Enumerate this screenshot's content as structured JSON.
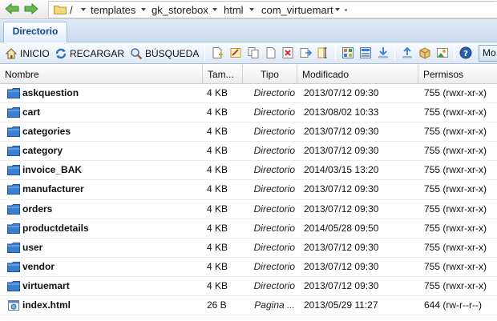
{
  "breadcrumb": {
    "items": [
      "/",
      "templates",
      "gk_storebox",
      "html",
      "com_virtuemart"
    ]
  },
  "tabs": [
    {
      "label": "Directorio"
    }
  ],
  "toolbar": {
    "home_label": "INICIO",
    "reload_label": "RECARGAR",
    "search_label": "BÚSQUEDA",
    "mode_label": "Mo"
  },
  "columns": {
    "name": "Nombre",
    "size": "Tam...",
    "type": "Tipo",
    "modified": "Modificado",
    "permissions": "Permisos"
  },
  "files": [
    {
      "name": "askquestion",
      "size": "4 KB",
      "type": "Directorio",
      "modified": "2013/07/12 09:30",
      "permissions": "755 (rwxr-xr-x)",
      "icon": "folder-icon"
    },
    {
      "name": "cart",
      "size": "4 KB",
      "type": "Directorio",
      "modified": "2013/08/02 10:33",
      "permissions": "755 (rwxr-xr-x)",
      "icon": "folder-icon"
    },
    {
      "name": "categories",
      "size": "4 KB",
      "type": "Directorio",
      "modified": "2013/07/12 09:30",
      "permissions": "755 (rwxr-xr-x)",
      "icon": "folder-icon"
    },
    {
      "name": "category",
      "size": "4 KB",
      "type": "Directorio",
      "modified": "2013/07/12 09:30",
      "permissions": "755 (rwxr-xr-x)",
      "icon": "folder-icon"
    },
    {
      "name": "invoice_BAK",
      "size": "4 KB",
      "type": "Directorio",
      "modified": "2014/03/15 13:20",
      "permissions": "755 (rwxr-xr-x)",
      "icon": "folder-icon"
    },
    {
      "name": "manufacturer",
      "size": "4 KB",
      "type": "Directorio",
      "modified": "2013/07/12 09:30",
      "permissions": "755 (rwxr-xr-x)",
      "icon": "folder-icon"
    },
    {
      "name": "orders",
      "size": "4 KB",
      "type": "Directorio",
      "modified": "2013/07/12 09:30",
      "permissions": "755 (rwxr-xr-x)",
      "icon": "folder-icon"
    },
    {
      "name": "productdetails",
      "size": "4 KB",
      "type": "Directorio",
      "modified": "2014/05/28 09:50",
      "permissions": "755 (rwxr-xr-x)",
      "icon": "folder-icon"
    },
    {
      "name": "user",
      "size": "4 KB",
      "type": "Directorio",
      "modified": "2013/07/12 09:30",
      "permissions": "755 (rwxr-xr-x)",
      "icon": "folder-icon"
    },
    {
      "name": "vendor",
      "size": "4 KB",
      "type": "Directorio",
      "modified": "2013/07/12 09:30",
      "permissions": "755 (rwxr-xr-x)",
      "icon": "folder-icon"
    },
    {
      "name": "virtuemart",
      "size": "4 KB",
      "type": "Directorio",
      "modified": "2013/07/12 09:30",
      "permissions": "755 (rwxr-xr-x)",
      "icon": "folder-icon"
    },
    {
      "name": "index.html",
      "size": "26 B",
      "type": "Pagina ...",
      "modified": "2013/05/29 11:27",
      "permissions": "644 (rw-r--r--)",
      "icon": "html-file-icon"
    }
  ],
  "colors": {
    "accent": "#15428b",
    "folder": "#2f6fbf",
    "nav_arrow": "#5aa83a"
  }
}
